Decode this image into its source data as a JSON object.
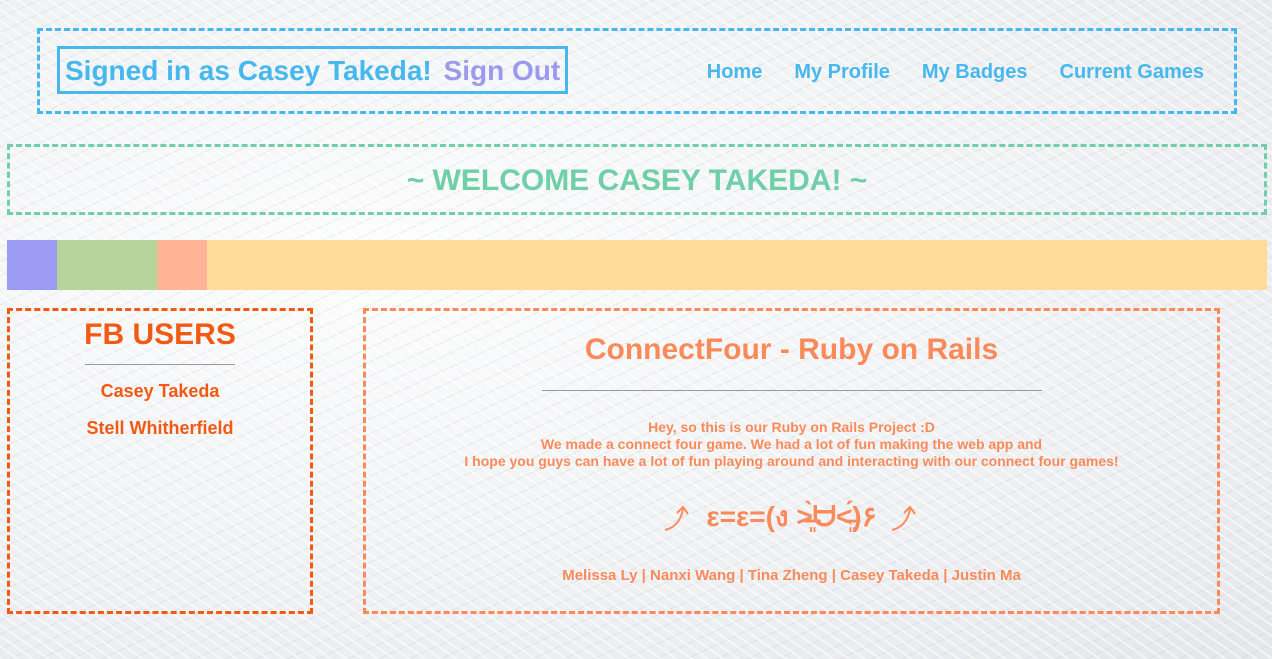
{
  "header": {
    "signed_in_text": "Signed in as Casey Takeda!",
    "sign_out_label": "Sign Out",
    "nav": [
      "Home",
      "My Profile",
      "My Badges",
      "Current Games"
    ]
  },
  "welcome": {
    "title": "~ WELCOME CASEY TAKEDA! ~"
  },
  "color_strip": [
    "#9b9bf4",
    "#b7d49c",
    "#ffb595",
    "#fedb98"
  ],
  "fb_users": {
    "title": "FB USERS",
    "users": [
      "Casey Takeda",
      "Stell Whitherfield"
    ]
  },
  "main": {
    "title": "ConnectFour - Ruby on Rails",
    "description": [
      "Hey, so this is our Ruby on Rails Project :D",
      "We made a connect four game. We had a lot of fun making the web app and",
      "I hope you guys can have a lot of fun playing around and interacting with our connect four games!"
    ],
    "kaomoji": "ε=ε=(ง ˃̶͈̀ᗨ˂̶͈́)۶",
    "team": "Melissa Ly | Nanxi Wang | Tina Zheng | Casey Takeda | Justin Ma"
  },
  "colors": {
    "header_blue": "#46b8ee",
    "sign_out_purple": "#9a9aee",
    "welcome_green": "#6fcfa8",
    "fb_orange": "#f25a14",
    "main_orange": "#fb8a5a"
  }
}
